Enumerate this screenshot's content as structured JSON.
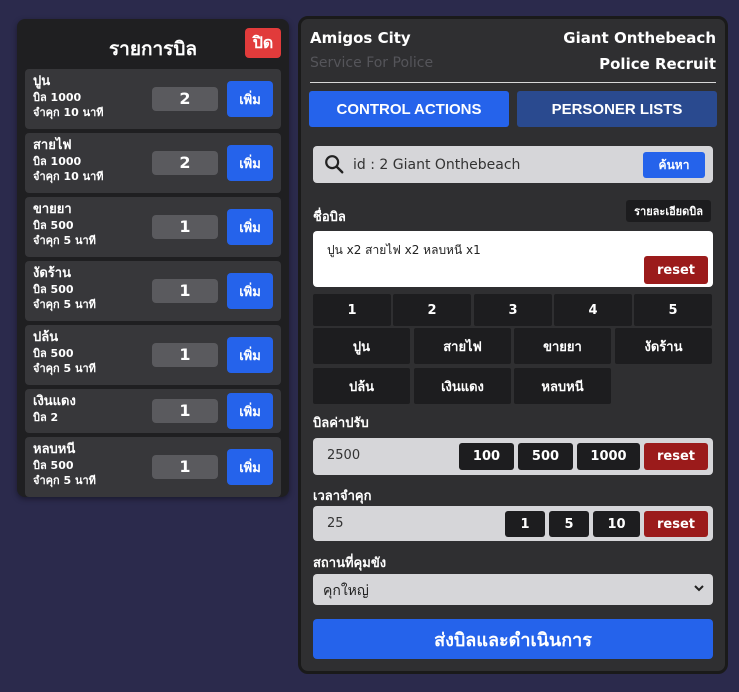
{
  "left": {
    "title": "รายการบิล",
    "close_label": "ปิด",
    "add_label": "เพิ่ม",
    "items": [
      {
        "name": "ปูน",
        "bill": "บิล 1000",
        "jail": "จำคุก 10 นาที",
        "qty": "2"
      },
      {
        "name": "สายไฟ",
        "bill": "บิล 1000",
        "jail": "จำคุก 10 นาที",
        "qty": "2"
      },
      {
        "name": "ขายยา",
        "bill": "บิล 500",
        "jail": "จำคุก 5 นาที",
        "qty": "1"
      },
      {
        "name": "งัดร้าน",
        "bill": "บิล 500",
        "jail": "จำคุก 5 นาที",
        "qty": "1"
      },
      {
        "name": "ปล้น",
        "bill": "บิล 500",
        "jail": "จำคุก 5 นาที",
        "qty": "1"
      },
      {
        "name": "เงินแดง",
        "bill": "บิล 2",
        "jail": "",
        "qty": "1"
      },
      {
        "name": "หลบหนี",
        "bill": "บิล 500",
        "jail": "จำคุก 5 นาที",
        "qty": "1"
      }
    ]
  },
  "header": {
    "org_name": "Amigos City",
    "org_sub": "Service For Police",
    "officer_name": "Giant Onthebeach",
    "officer_role": "Police Recruit"
  },
  "tabs": {
    "control": "CONTROL ACTIONS",
    "persons": "PERSONER LISTS"
  },
  "search": {
    "value": "id : 2 Giant Onthebeach",
    "button": "ค้นหา"
  },
  "bill": {
    "label": "ชื่อบิล",
    "detail_button": "รายละเอียดบิล",
    "text": "ปูน x2 สายไฟ x2 หลบหนี x1",
    "reset": "reset"
  },
  "numbers": [
    "1",
    "2",
    "3",
    "4",
    "5"
  ],
  "categories": [
    "ปูน",
    "สายไฟ",
    "ขายยา",
    "งัดร้าน",
    "ปล้น",
    "เงินแดง",
    "หลบหนี"
  ],
  "fine": {
    "label": "บิลค่าปรับ",
    "value": "2500",
    "presets": [
      "100",
      "500",
      "1000"
    ],
    "reset": "reset"
  },
  "jail": {
    "label": "เวลาจำคุก",
    "value": "25",
    "presets": [
      "1",
      "5",
      "10"
    ],
    "reset": "reset"
  },
  "prison": {
    "label": "สถานที่คุมขัง",
    "selected": "คุกใหญ่"
  },
  "submit_label": "ส่งบิลและดำเนินการ",
  "colors": {
    "background": "#2b2a4c",
    "accent": "#2563eb",
    "danger": "#e13b3b",
    "reset": "#9b1b1b"
  }
}
